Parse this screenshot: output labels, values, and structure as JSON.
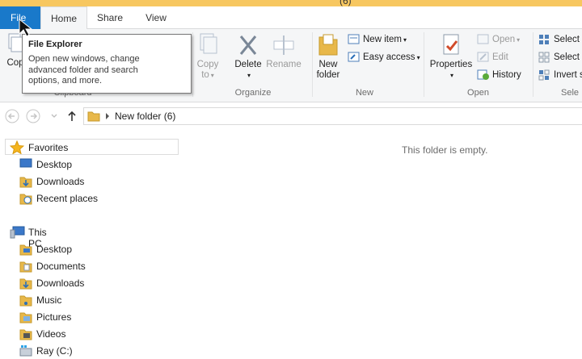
{
  "titlebar": {
    "title": "(6)"
  },
  "tabs": {
    "file": "File",
    "home": "Home",
    "share": "Share",
    "view": "View"
  },
  "ribbon": {
    "clipboard": {
      "copy_partial": "Cop",
      "label": "Clipboard"
    },
    "organize": {
      "copy_to": "Copy to",
      "delete": "Delete",
      "rename": "Rename",
      "label": "Organize"
    },
    "new": {
      "new_folder": "New folder",
      "new_item": "New item",
      "easy_access": "Easy access",
      "label": "New"
    },
    "open": {
      "properties": "Properties",
      "open": "Open",
      "edit": "Edit",
      "history": "History",
      "label": "Open"
    },
    "select": {
      "select_all": "Select a",
      "select_none": "Select n",
      "invert": "Invert s",
      "label": "Sele"
    }
  },
  "tooltip": {
    "title": "File Explorer",
    "body": "Open new windows, change advanced folder and search options, and more."
  },
  "address": {
    "path": "New folder (6)"
  },
  "nav": {
    "favorites": "Favorites",
    "fav_items": [
      "Desktop",
      "Downloads",
      "Recent places"
    ],
    "this_pc": "This PC",
    "pc_items": [
      "Desktop",
      "Documents",
      "Downloads",
      "Music",
      "Pictures",
      "Videos",
      "Ray (C:)"
    ]
  },
  "content": {
    "empty": "This folder is empty."
  },
  "colors": {
    "file_tab": "#1979ca",
    "titlebar": "#f7c760",
    "folder": "#e8b84a",
    "accent": "#2b6fb8"
  }
}
